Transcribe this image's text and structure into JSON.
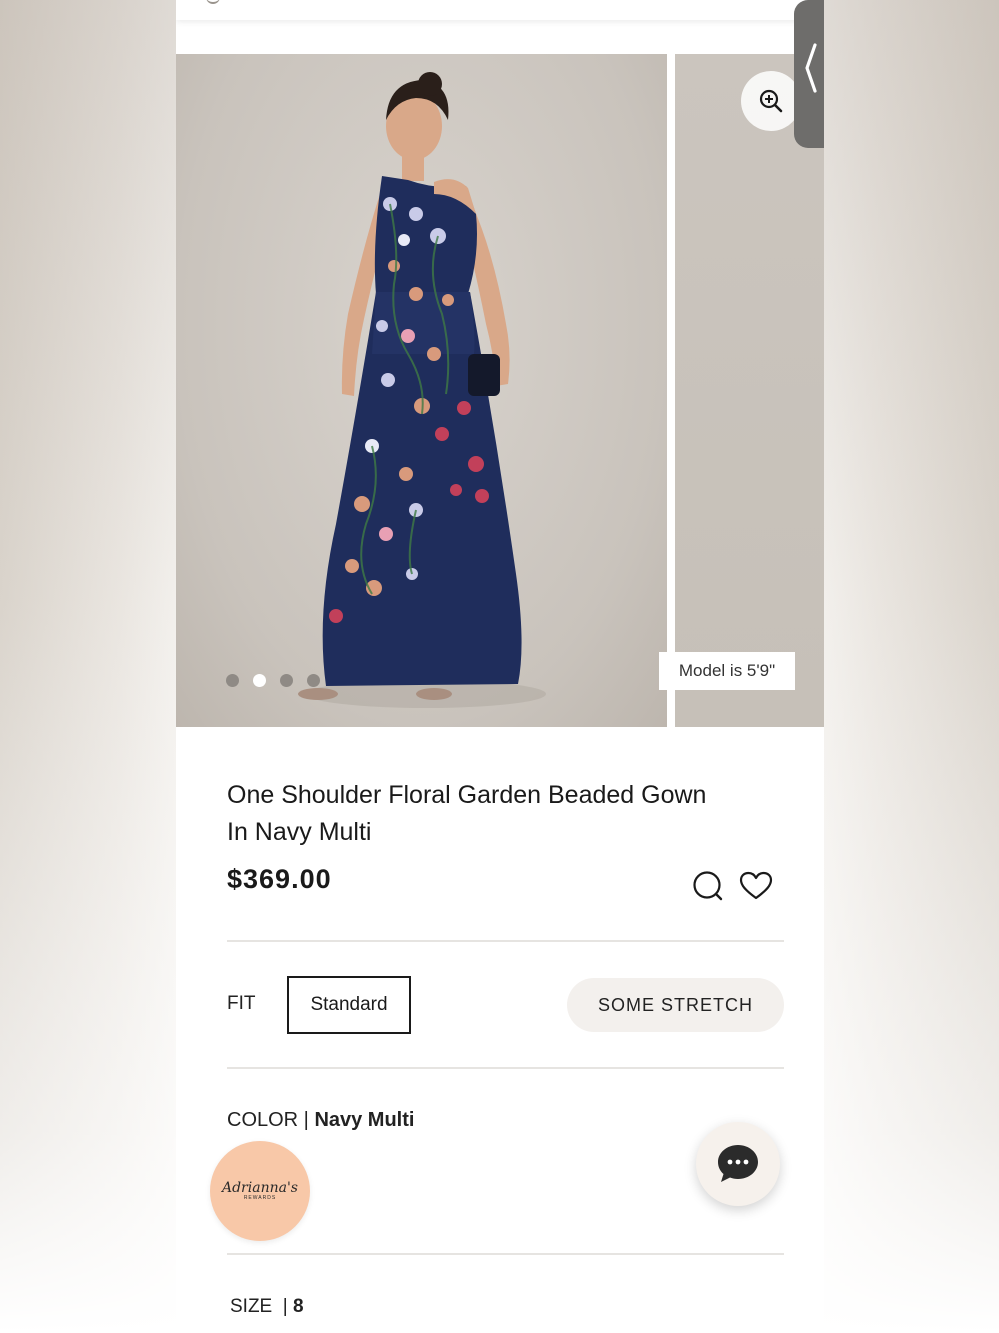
{
  "gallery": {
    "model_badge": "Model is 5'9\"",
    "slide_count": 4,
    "active_slide": 2,
    "icons": {
      "zoom": "zoom-in-icon",
      "side_tab": "chevron-left-icon"
    }
  },
  "product": {
    "title_line1": "One Shoulder Floral Garden Beaded Gown",
    "title_line2": "In Navy Multi",
    "price": "$369.00",
    "icons": {
      "compare": "speech-bubble-icon",
      "wishlist": "heart-icon"
    }
  },
  "fit": {
    "label": "FIT",
    "selected": "Standard",
    "stretch": "SOME STRETCH"
  },
  "color": {
    "label": "COLOR |",
    "value": "Navy Multi"
  },
  "size": {
    "label": "SIZE",
    "separator": "|",
    "value": "8"
  },
  "rewards": {
    "script": "Adrianna's",
    "sub": "REWARDS"
  },
  "colors": {
    "accent_peach": "#f8c8a8",
    "chat_dark": "#2b2b2b",
    "text": "#1a1a1a",
    "dress_navy": "#1f2d5c"
  }
}
